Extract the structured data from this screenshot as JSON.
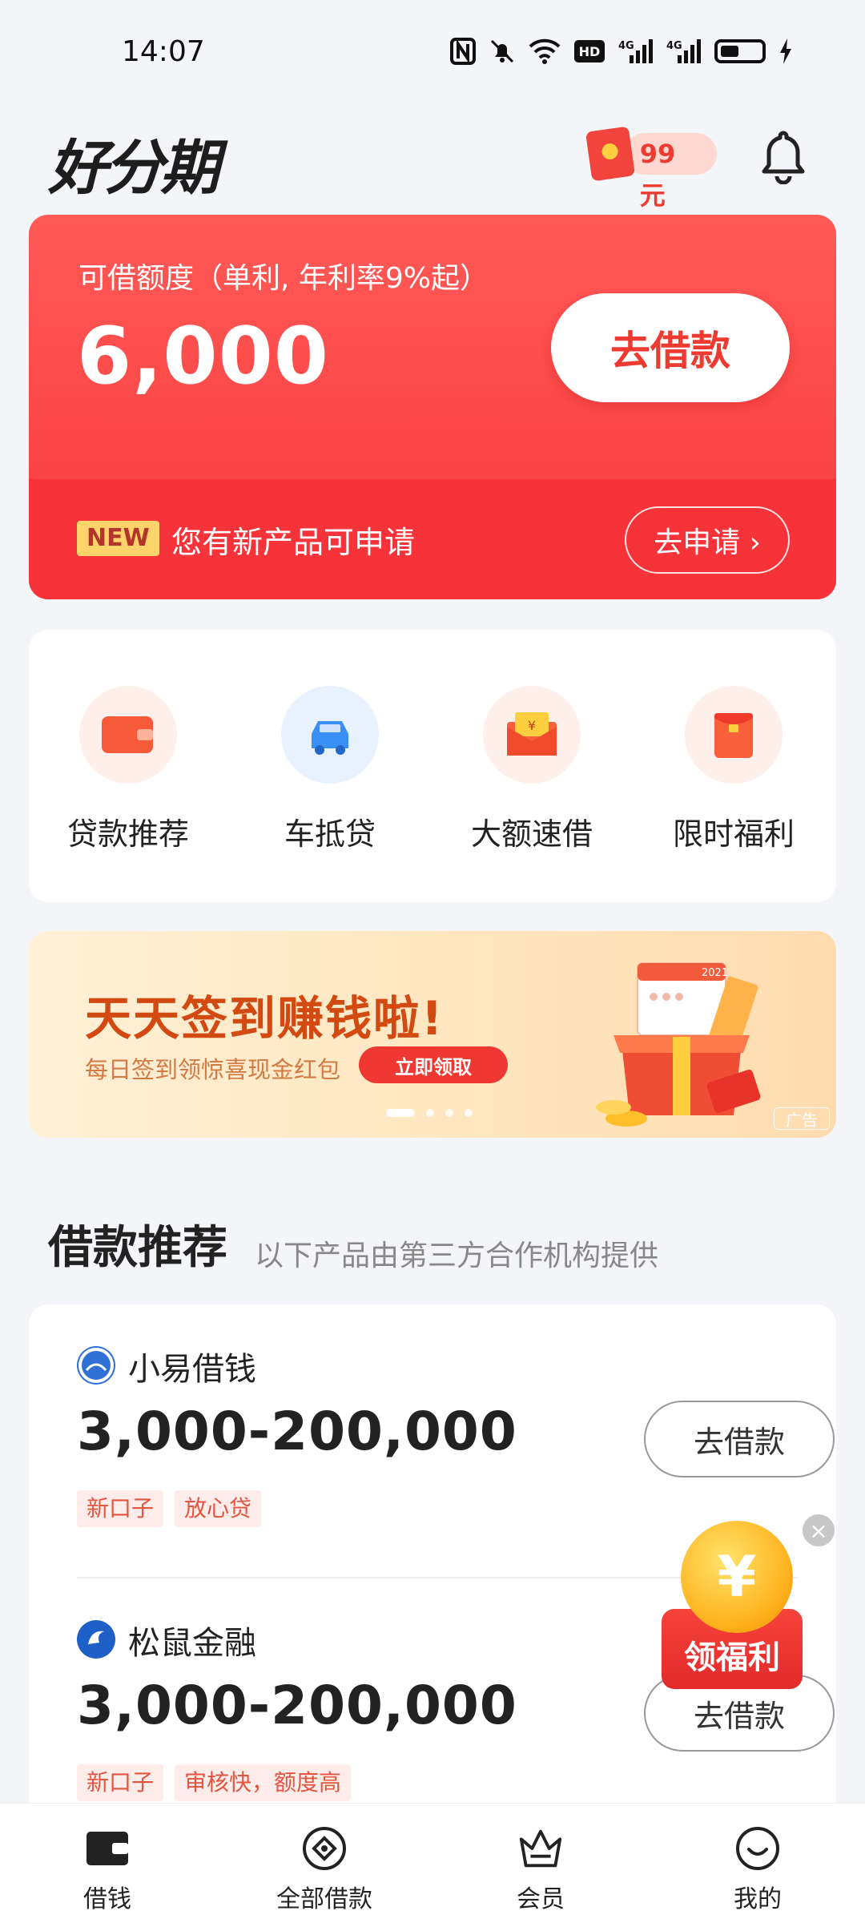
{
  "status_bar": {
    "time": "14:07"
  },
  "header": {
    "logo": "好分期",
    "red_packet_amount": "99元"
  },
  "loan_card": {
    "credit_label": "可借额度（单利, 年利率9%起）",
    "credit_amount": "6,000",
    "borrow_button": "去借款",
    "new_badge": "NEW",
    "new_text": "您有新产品可申请",
    "apply_button": "去申请 ›"
  },
  "services": [
    {
      "label": "贷款推荐",
      "icon": "wallet-icon",
      "color": "#f75a3a"
    },
    {
      "label": "车抵贷",
      "icon": "car-icon",
      "color": "#3a8ff5"
    },
    {
      "label": "大额速借",
      "icon": "envelope-icon",
      "color": "#f7603a"
    },
    {
      "label": "限时福利",
      "icon": "red-packet-icon",
      "color": "#f7603a"
    }
  ],
  "banner": {
    "title": "天天签到赚钱啦!",
    "subtitle": "每日签到领惊喜现金红包",
    "button": "立即领取",
    "ad_tag": "广告",
    "gift_year": "2021"
  },
  "section": {
    "title": "借款推荐",
    "subtitle": "以下产品由第三方合作机构提供"
  },
  "products": [
    {
      "name": "小易借钱",
      "range": "3,000-200,000",
      "tags": [
        "新口子",
        "放心贷"
      ],
      "button": "去借款",
      "logo_color": "#2f6fd6"
    },
    {
      "name": "松鼠金融",
      "range": "3,000-200,000",
      "tags": [
        "新口子",
        "审核快，额度高"
      ],
      "button": "去借款",
      "logo_color": "#1f5fc8"
    }
  ],
  "floating_welfare": {
    "label": "领福利",
    "coin_symbol": "¥"
  },
  "bottom_nav": [
    {
      "label": "借钱",
      "icon": "wallet-icon"
    },
    {
      "label": "全部借款",
      "icon": "diamond-circle-icon"
    },
    {
      "label": "会员",
      "icon": "crown-icon"
    },
    {
      "label": "我的",
      "icon": "smile-icon"
    }
  ]
}
